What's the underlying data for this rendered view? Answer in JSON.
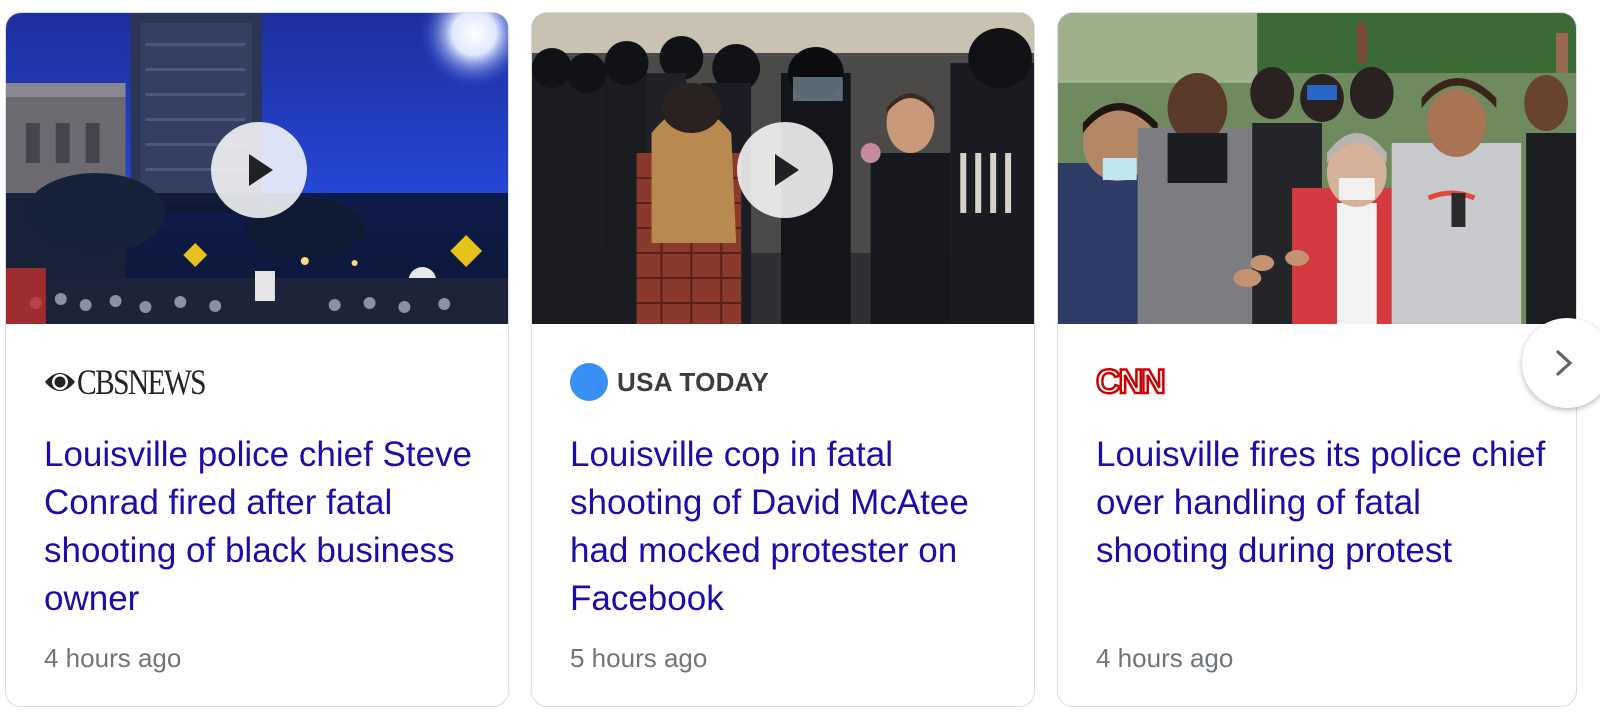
{
  "articles": [
    {
      "source": "CBSNEWS",
      "headline": "Louisville police chief Steve Conrad fired after fatal shooting of black business owner",
      "time": "4 hours ago",
      "has_video": true
    },
    {
      "source": "USA TODAY",
      "headline": "Louisville cop in fatal shooting of David McAtee had mocked protester on Facebook",
      "time": "5 hours ago",
      "has_video": true
    },
    {
      "source": "CNN",
      "headline": "Louisville fires its police chief over handling of fatal shooting during protest",
      "time": "4 hours ago",
      "has_video": false
    }
  ],
  "icons": {
    "play": "play-icon",
    "next": "chevron-right-icon"
  },
  "colors": {
    "headline": "#1a0dab",
    "time": "#70757a",
    "usa_today_dot": "#3a8ff5",
    "cnn_red": "#cc0000"
  }
}
